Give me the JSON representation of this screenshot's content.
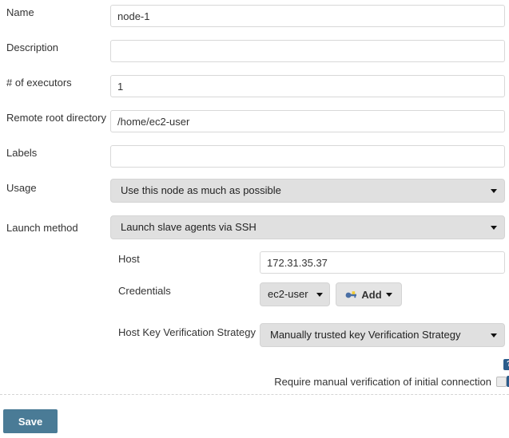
{
  "form": {
    "fields": [
      {
        "label": "Name",
        "value": "node-1",
        "placeholder": "",
        "type": "text"
      },
      {
        "label": "Description",
        "value": "",
        "placeholder": "",
        "type": "text"
      },
      {
        "label": "# of executors",
        "value": "1",
        "placeholder": "",
        "type": "text"
      },
      {
        "label": "Remote root directory",
        "value": "/home/ec2-user",
        "placeholder": "",
        "type": "text"
      },
      {
        "label": "Labels",
        "value": "",
        "placeholder": "",
        "type": "text"
      },
      {
        "label": "Usage",
        "value": "Use this node as much as possible",
        "type": "select"
      },
      {
        "label": "Launch method",
        "value": "Launch slave agents via SSH",
        "type": "select"
      }
    ],
    "ssh": {
      "host": {
        "label": "Host",
        "value": "172.31.35.37",
        "placeholder": ""
      },
      "credentials": {
        "label": "Credentials",
        "value": "ec2-user",
        "add_label": "Add",
        "add_icon": "key-icon"
      },
      "host_key_strategy": {
        "label": "Host Key Verification Strategy",
        "value": "Manually trusted key Verification Strategy"
      },
      "require_manual_verification": {
        "label": "Require manual verification of initial connection",
        "checked": false
      }
    },
    "save_label": "Save",
    "help_icon_label": "?",
    "colors": {
      "save_button": "#4a7b96",
      "select_background": "#e0e0e0",
      "help_icon": "#2b5d8c",
      "input_border": "#d8d8d8",
      "label_text": "#333333"
    }
  }
}
